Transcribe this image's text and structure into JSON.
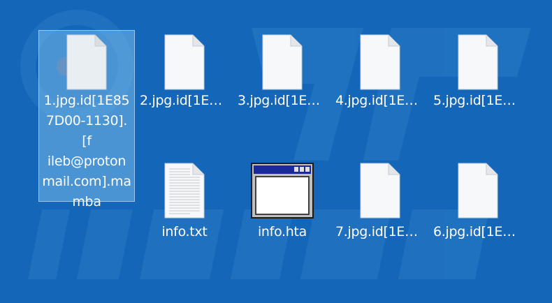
{
  "desktop": {
    "background_color": "#1366b8",
    "files": [
      {
        "name": "1.jpg.id[1E857D00-1130].[fileb@protonmail.com].mamba",
        "lines": [
          "1.jpg.id[1E85",
          "7D00-1130].[f",
          "ileb@proton",
          "mail.com].ma",
          "mba"
        ],
        "icon": "blank-document-icon",
        "selected": true
      },
      {
        "name": "2.jpg.id[1E8…",
        "icon": "blank-document-icon"
      },
      {
        "name": "3.jpg.id[1E8…",
        "icon": "blank-document-icon"
      },
      {
        "name": "4.jpg.id[1E8…",
        "icon": "blank-document-icon"
      },
      {
        "name": "5.jpg.id[1E8…",
        "icon": "blank-document-icon"
      },
      {
        "name": "info.txt",
        "icon": "text-document-icon"
      },
      {
        "name": "info.hta",
        "icon": "application-window-icon"
      },
      {
        "name": "7.jpg.id[1E8…",
        "icon": "blank-document-icon"
      },
      {
        "name": "6.jpg.id[1E8…",
        "icon": "blank-document-icon"
      }
    ]
  }
}
